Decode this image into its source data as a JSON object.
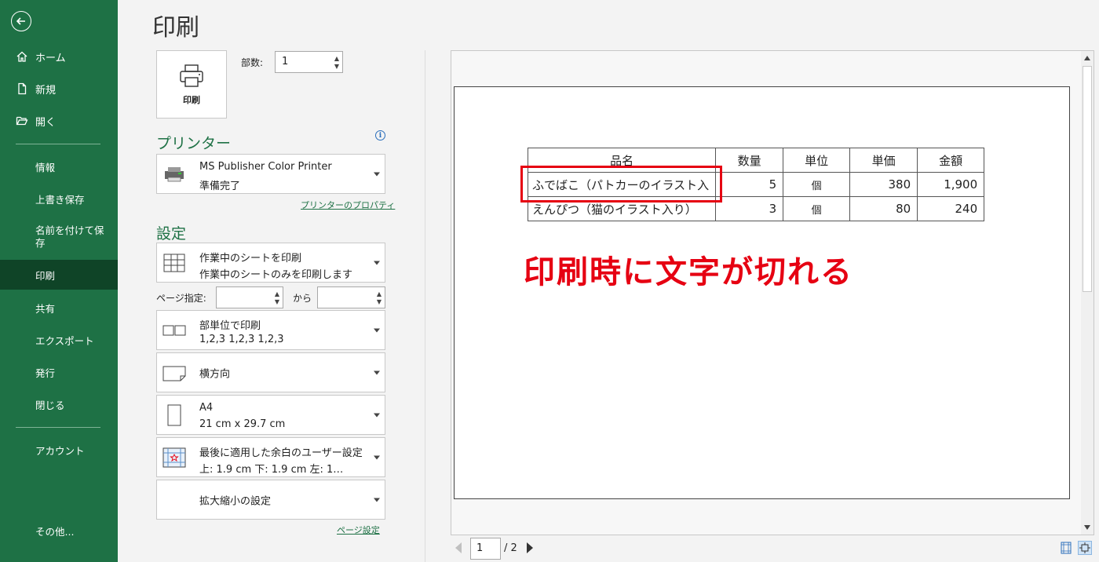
{
  "sidebar": {
    "back_icon": "arrow-left-icon",
    "top_items": [
      {
        "label": "ホーム",
        "icon": "home-icon"
      },
      {
        "label": "新規",
        "icon": "new-document-icon"
      },
      {
        "label": "開く",
        "icon": "folder-open-icon"
      }
    ],
    "items": [
      "情報",
      "上書き保存",
      "名前を付けて保存",
      "印刷",
      "共有",
      "エクスポート",
      "発行",
      "閉じる"
    ],
    "active_item": "印刷",
    "account": "アカウント",
    "more": "その他..."
  },
  "page_title": "印刷",
  "print_button_label": "印刷",
  "copies": {
    "label": "部数:",
    "value": "1"
  },
  "printer": {
    "section_title": "プリンター",
    "name": "MS Publisher Color Printer",
    "status": "準備完了",
    "properties_link": "プリンターのプロパティ"
  },
  "settings": {
    "section_title": "設定",
    "print_what": {
      "line1": "作業中のシートを印刷",
      "line2": "作業中のシートのみを印刷します"
    },
    "pages_label": "ページ指定:",
    "pages_to_label": "から",
    "collate": {
      "line1": "部単位で印刷",
      "line2": "1,2,3    1,2,3    1,2,3"
    },
    "orientation": "横方向",
    "paper": {
      "line1": "A4",
      "line2": "21 cm x 29.7 cm"
    },
    "margins": {
      "line1": "最後に適用した余白のユーザー設定",
      "line2": "上: 1.9 cm 下: 1.9 cm 左: 1…"
    },
    "scaling": "拡大縮小の設定",
    "page_setup_link": "ページ設定"
  },
  "preview": {
    "table": {
      "headers": [
        "品名",
        "数量",
        "単位",
        "単価",
        "金額"
      ],
      "rows": [
        [
          "ふでばこ（パトカーのイラスト入",
          "5",
          "個",
          "380",
          "1,900"
        ],
        [
          "えんぴつ（猫のイラスト入り）",
          "3",
          "個",
          "80",
          "240"
        ]
      ]
    },
    "annotation": "印刷時に文字が切れる",
    "highlight_color": "#e60012"
  },
  "page_nav": {
    "current": "1",
    "total": "/ 2"
  },
  "colors": {
    "sidebar": "#1e7145",
    "sidebar_active": "#0f4427",
    "accent": "#1e7145"
  }
}
